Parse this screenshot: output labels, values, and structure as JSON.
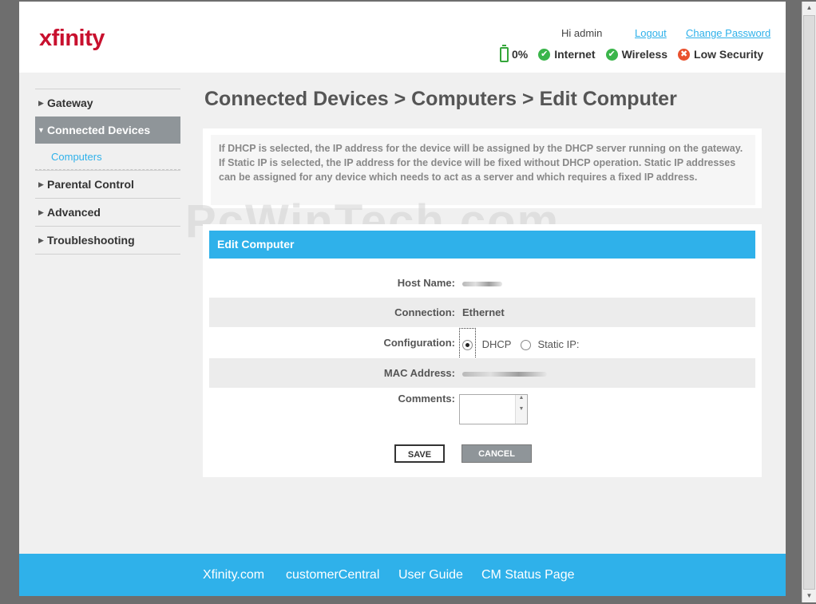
{
  "header": {
    "logo": "xfinity",
    "greeting": "Hi admin",
    "logout": "Logout",
    "change_password": "Change Password",
    "status": {
      "battery": "0%",
      "internet": "Internet",
      "wireless": "Wireless",
      "security": "Low Security"
    }
  },
  "sidebar": {
    "items": [
      {
        "label": "Gateway"
      },
      {
        "label": "Connected Devices"
      },
      {
        "label": "Computers"
      },
      {
        "label": "Parental Control"
      },
      {
        "label": "Advanced"
      },
      {
        "label": "Troubleshooting"
      }
    ]
  },
  "main": {
    "title": "Connected Devices > Computers > Edit Computer",
    "info": "If DHCP is selected, the IP address for the device will be assigned by the DHCP server running on the gateway. If Static IP is selected, the IP address for the device will be fixed without DHCP operation. Static IP addresses can be assigned for any device which needs to act as a server and which requires a fixed IP address.",
    "form": {
      "header": "Edit Computer",
      "host_name_label": "Host Name:",
      "connection_label": "Connection:",
      "connection_value": "Ethernet",
      "configuration_label": "Configuration:",
      "dhcp_label": "DHCP",
      "static_label": "Static IP:",
      "mac_label": "MAC Address:",
      "comments_label": "Comments:",
      "save": "SAVE",
      "cancel": "CANCEL"
    }
  },
  "watermark": "PcWinTech.com",
  "footer": {
    "links": [
      "Xfinity.com",
      "customerCentral",
      "User Guide",
      "CM Status Page"
    ]
  },
  "colors": {
    "accent": "#2fb1ea",
    "brand": "#c8102e",
    "ok": "#3ab54a",
    "warning": "#e9512e"
  }
}
